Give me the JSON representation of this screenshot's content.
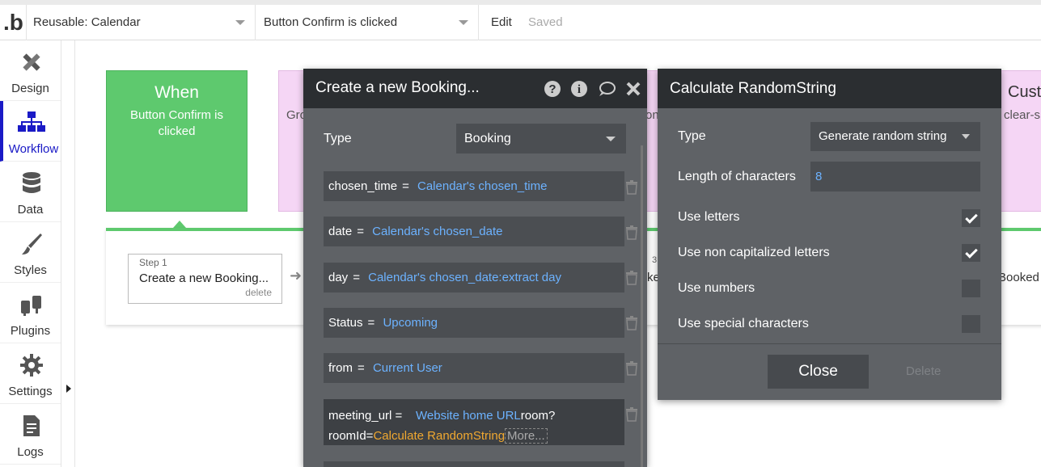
{
  "topbar": {
    "page_select": "Reusable: Calendar",
    "event_select": "Button Confirm is clicked",
    "edit_label": "Edit",
    "saved_label": "Saved"
  },
  "sidebar": {
    "items": [
      {
        "label": "Design",
        "icon": "design-icon"
      },
      {
        "label": "Workflow",
        "icon": "workflow-icon",
        "active": true
      },
      {
        "label": "Data",
        "icon": "database-icon"
      },
      {
        "label": "Styles",
        "icon": "brush-icon"
      },
      {
        "label": "Plugins",
        "icon": "plugin-icon"
      },
      {
        "label": "Settings",
        "icon": "gear-icon"
      },
      {
        "label": "Logs",
        "icon": "document-icon"
      }
    ]
  },
  "canvas": {
    "when_title": "When",
    "when_sub": "Button Confirm is clicked",
    "pink_text": "Gro",
    "on_text": "on",
    "cust_text": "Cust",
    "clear_text": "clear-s",
    "step": {
      "num": "Step 1",
      "title": "Create a new Booking...",
      "delete": "delete"
    },
    "step3_text": "3",
    "ke_text": "ke",
    "booked_text": "Booked"
  },
  "booking_panel": {
    "title": "Create a new Booking...",
    "type_label": "Type",
    "type_value": "Booking",
    "fields": [
      {
        "key": "chosen_time",
        "value": "Calendar's chosen_time"
      },
      {
        "key": "date",
        "value": "Calendar's chosen_date"
      },
      {
        "key": "day",
        "value": "Calendar's chosen_date:extract day"
      },
      {
        "key": "Status",
        "value": "Upcoming"
      },
      {
        "key": "from",
        "value": "Current User"
      }
    ],
    "meeting": {
      "key": "meeting_url",
      "value_link": "Website home URL",
      "value_plain1": "room?",
      "value_plain2": "roomId=",
      "value_expr": "Calculate RandomString",
      "more": "More..."
    }
  },
  "random_panel": {
    "title": "Calculate RandomString",
    "type_label": "Type",
    "type_value": "Generate random string",
    "length_label": "Length of characters",
    "length_value": "8",
    "options": [
      {
        "label": "Use letters",
        "checked": true
      },
      {
        "label": "Use non capitalized letters",
        "checked": true
      },
      {
        "label": "Use numbers",
        "checked": false
      },
      {
        "label": "Use special characters",
        "checked": false
      }
    ],
    "close_label": "Close",
    "delete_label": "Delete"
  }
}
